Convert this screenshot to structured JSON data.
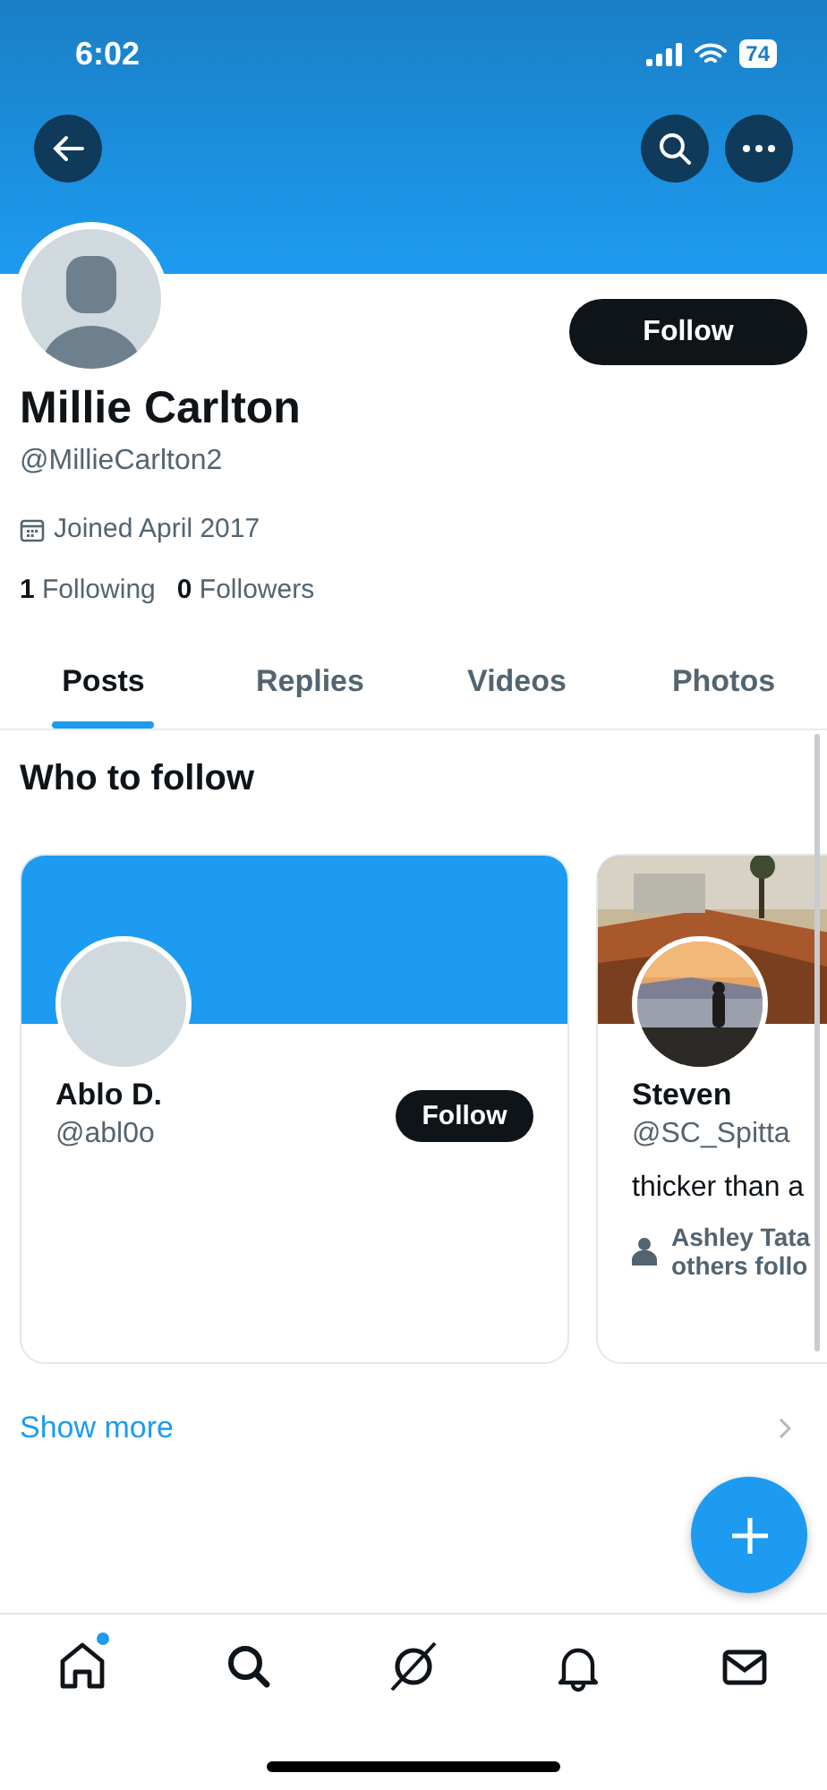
{
  "status_bar": {
    "time": "6:02",
    "battery": "74"
  },
  "profile": {
    "name": "Millie Carlton",
    "handle": "@MillieCarlton2",
    "joined": "Joined April 2017",
    "following_count": "1",
    "following_label": "Following",
    "followers_count": "0",
    "followers_label": "Followers",
    "follow_button": "Follow"
  },
  "tabs": [
    {
      "label": "Posts",
      "selected": true
    },
    {
      "label": "Replies",
      "selected": false
    },
    {
      "label": "Videos",
      "selected": false
    },
    {
      "label": "Photos",
      "selected": false
    }
  ],
  "who_to_follow": {
    "title": "Who to follow",
    "cards": [
      {
        "kind": "plain",
        "name": "Ablo D.",
        "handle": "@abl0o",
        "follow_button": "Follow"
      },
      {
        "kind": "picture",
        "name": "Steven",
        "handle": "@SC_Spitta",
        "bio": "thicker than a",
        "followed_by": [
          "Ashley Tata",
          "others follo"
        ]
      }
    ],
    "show_more": "Show more"
  },
  "bottom_nav": [
    {
      "kind": "home",
      "badge": true
    },
    {
      "kind": "search",
      "badge": false
    },
    {
      "kind": "grok",
      "badge": false
    },
    {
      "kind": "notifications",
      "badge": false
    },
    {
      "kind": "messages",
      "badge": false
    }
  ]
}
